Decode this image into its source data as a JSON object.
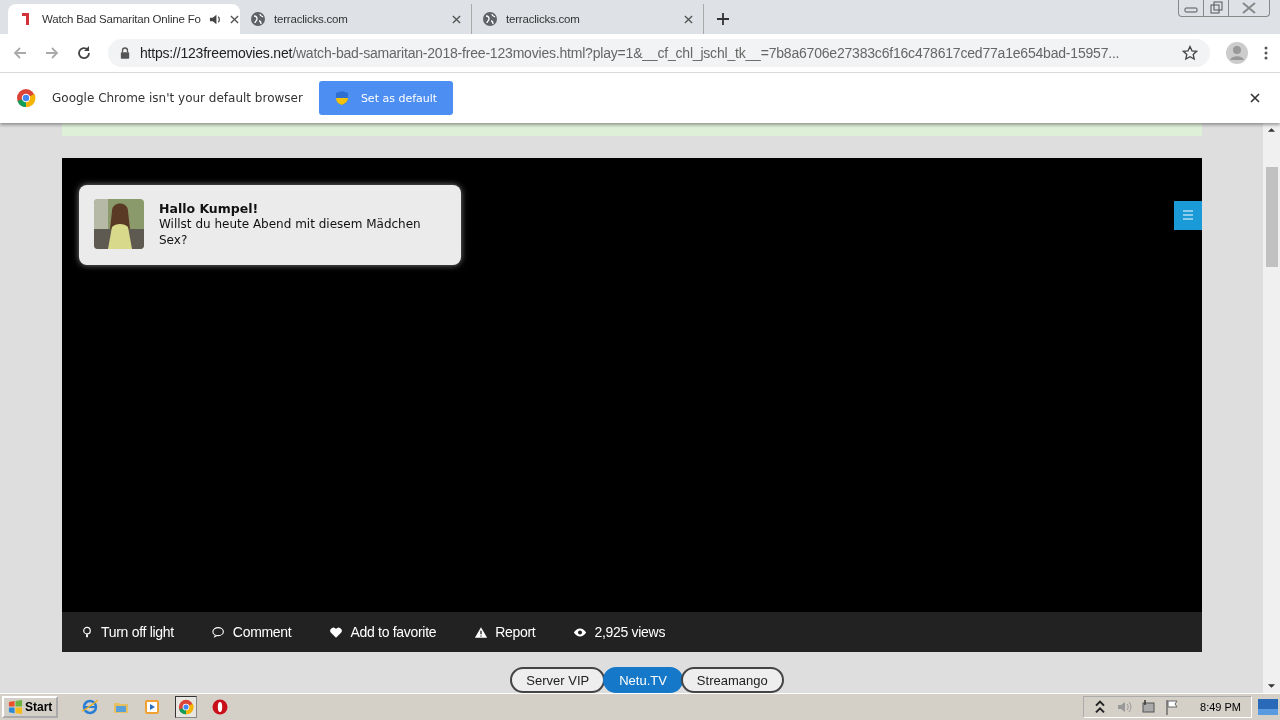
{
  "tabs": [
    {
      "title": "Watch Bad Samaritan Online Fo",
      "kind": "site",
      "selected": true,
      "audio": true
    },
    {
      "title": "terraclicks.com",
      "kind": "globe",
      "selected": false,
      "audio": false
    },
    {
      "title": "terraclicks.com",
      "kind": "globe",
      "selected": false,
      "audio": false
    }
  ],
  "address": {
    "host": "https://123freemovies.net",
    "path": "/watch-bad-samaritan-2018-free-123movies.html?play=1&__cf_chl_jschl_tk__=7b8a6706e27383c6f16c478617ced77a1e654bad-15957..."
  },
  "infobar": {
    "message": "Google Chrome isn't your default browser",
    "button": "Set as default"
  },
  "notification": {
    "title": "Hallo Kumpel!",
    "message": "Willst du heute Abend mit diesem Mädchen Sex?"
  },
  "player_bar": [
    {
      "label": "Turn off light",
      "kind": "bulb"
    },
    {
      "label": "Comment",
      "kind": "comment"
    },
    {
      "label": "Add to favorite",
      "kind": "heart"
    },
    {
      "label": "Report",
      "kind": "warning"
    },
    {
      "label": "2,925 views",
      "kind": "eye"
    }
  ],
  "servers": [
    {
      "label": "Server VIP",
      "selected": false
    },
    {
      "label": "Netu.TV",
      "selected": true
    },
    {
      "label": "Streamango",
      "selected": false
    }
  ],
  "taskbar": {
    "start": "Start",
    "clock": "8:49 PM"
  }
}
